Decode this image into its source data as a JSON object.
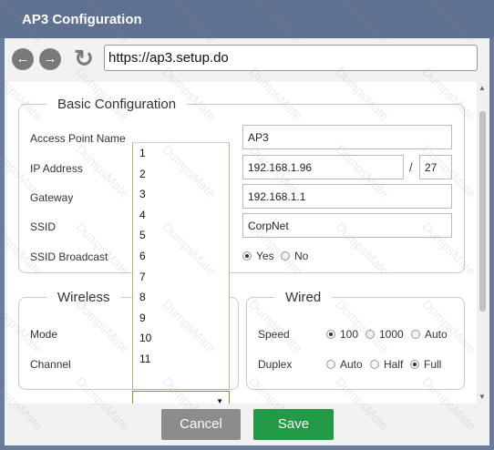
{
  "window": {
    "title": "AP3 Configuration"
  },
  "browser": {
    "url": "https://ap3.setup.do",
    "back_icon": "back-arrow-icon",
    "forward_icon": "forward-arrow-icon",
    "refresh_icon": "refresh-icon"
  },
  "basic": {
    "legend": "Basic Configuration",
    "access_point_name_label": "Access Point Name",
    "access_point_name_value": "AP3",
    "ip_label": "IP Address",
    "ip_value": "192.168.1.96",
    "ip_separator": "/",
    "prefix_value": "27",
    "gateway_label": "Gateway",
    "gateway_value": "192.168.1.1",
    "ssid_label": "SSID",
    "ssid_value": "CorpNet",
    "broadcast_label": "SSID Broadcast",
    "broadcast_options": [
      {
        "label": "Yes",
        "selected": true
      },
      {
        "label": "No",
        "selected": false
      }
    ]
  },
  "wireless": {
    "legend": "Wireless",
    "mode_label": "Mode",
    "channel_label": "Channel",
    "channel_options": [
      "1",
      "2",
      "3",
      "4",
      "5",
      "6",
      "7",
      "8",
      "9",
      "10",
      "11"
    ],
    "channel_selected": ""
  },
  "wired": {
    "legend": "Wired",
    "speed_label": "Speed",
    "speed_options": [
      {
        "label": "100",
        "selected": true
      },
      {
        "label": "1000",
        "selected": false
      },
      {
        "label": "Auto",
        "selected": false
      }
    ],
    "duplex_label": "Duplex",
    "duplex_options": [
      {
        "label": "Auto",
        "selected": false
      },
      {
        "label": "Half",
        "selected": false
      },
      {
        "label": "Full",
        "selected": true
      }
    ]
  },
  "footer": {
    "cancel_label": "Cancel",
    "save_label": "Save"
  },
  "watermark": "DumpsMate",
  "colors": {
    "titlebar": "#5f7190",
    "save": "#229944",
    "cancel": "#8c8c8c"
  }
}
